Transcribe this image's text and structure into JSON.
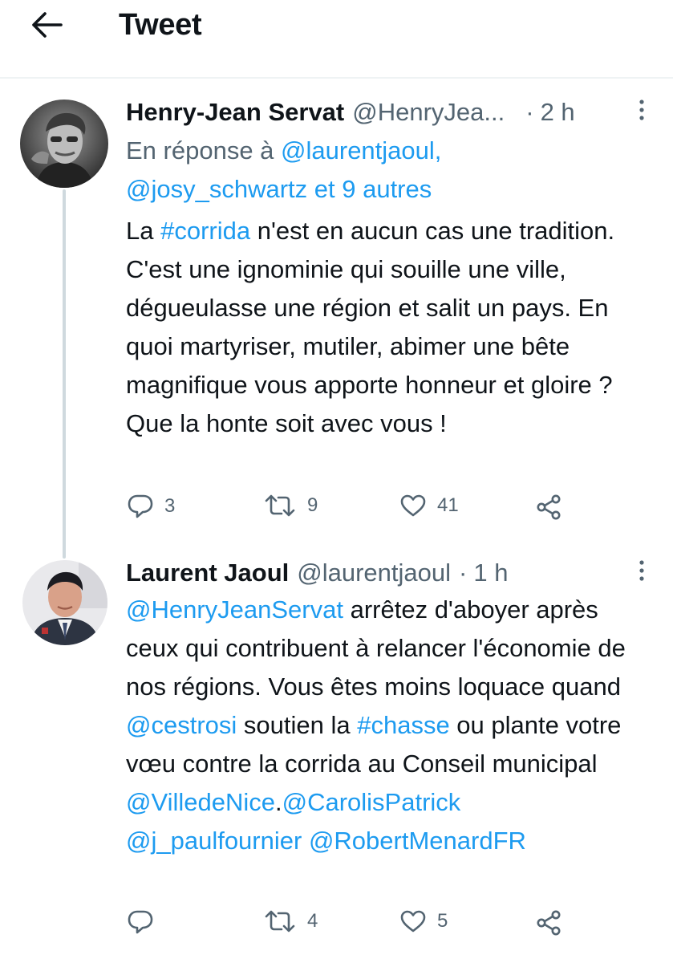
{
  "header": {
    "title": "Tweet"
  },
  "tweets": [
    {
      "name": "Henry-Jean Servat",
      "handle": "@HenryJea...",
      "dot": "·",
      "time": "2 h",
      "reply_prefix": "En réponse à ",
      "reply_user1": "@laurentjaoul,",
      "reply_user2": "@josy_schwartz",
      "reply_others": " et 9 autres",
      "body": {
        "t1": "La ",
        "hashtag": "#corrida",
        "t2": " n'est en aucun cas une tradition. C'est une ignominie qui souille une ville, dégueulasse une région et salit un pays. En quoi martyriser, mutiler, abimer une bête magnifique vous apporte honneur et gloire ? Que la honte soit avec vous !"
      },
      "replies": "3",
      "retweets": "9",
      "likes": "41"
    },
    {
      "name": "Laurent Jaoul",
      "handle": "@laurentjaoul",
      "dot": "·",
      "time": "1 h",
      "body": {
        "m1": "@HenryJeanServat",
        "t1": " arrêtez d'aboyer après ceux qui contribuent à relancer l'économie de nos régions. Vous êtes moins loquace quand ",
        "m2": "@cestrosi",
        "t2": " soutien la ",
        "hashtag": "#chasse",
        "t3": " ou plante votre vœu contre la  corrida au Conseil municipal ",
        "m3": "@VilledeNice",
        "t4": ".",
        "m4": "@CarolisPatrick",
        "m5": "@j_paulfournier",
        "t5": " ",
        "m6": "@RobertMenardFR"
      },
      "replies": "",
      "retweets": "4",
      "likes": "5"
    }
  ],
  "icons": {
    "back": "arrow-left-icon",
    "more": "more-vertical-icon",
    "reply": "comment-icon",
    "retweet": "retweet-icon",
    "like": "heart-icon",
    "share": "share-icon"
  },
  "colors": {
    "link": "#1d9bf0",
    "secondary_text": "#536471",
    "thread_line": "#cfd9de"
  }
}
